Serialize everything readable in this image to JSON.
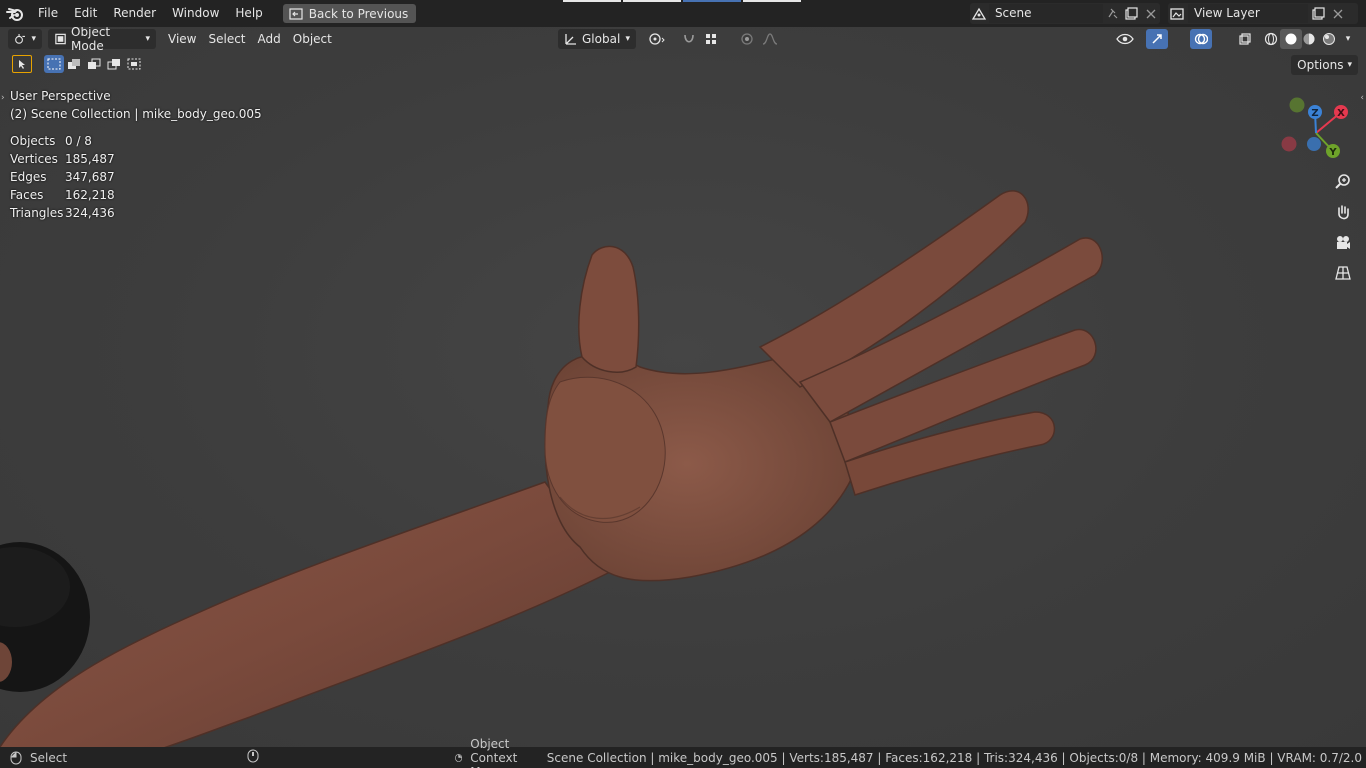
{
  "menu": {
    "items": [
      "File",
      "Edit",
      "Render",
      "Window",
      "Help"
    ],
    "back_label": "Back to Previous"
  },
  "scene": {
    "label": "Scene",
    "view_layer": "View Layer"
  },
  "header": {
    "mode_label": "Object Mode",
    "view": "View",
    "select": "Select",
    "add": "Add",
    "object": "Object",
    "transform_orientation": "Global",
    "options_label": "Options"
  },
  "overlay": {
    "perspective": "User Perspective",
    "collection": "(2) Scene Collection | mike_body_geo.005"
  },
  "stats": {
    "objects_label": "Objects",
    "objects_value": "0 / 8",
    "vertices_label": "Vertices",
    "vertices_value": "185,487",
    "edges_label": "Edges",
    "edges_value": "347,687",
    "faces_label": "Faces",
    "faces_value": "162,218",
    "triangles_label": "Triangles",
    "triangles_value": "324,436"
  },
  "gizmo": {
    "x": "X",
    "y": "Y",
    "z": "Z"
  },
  "status": {
    "select": "Select",
    "context_menu": "Object Context Menu",
    "info": "Scene Collection | mike_body_geo.005 | Verts:185,487 | Faces:162,218 | Tris:324,436 | Objects:0/8 | Memory: 409.9 MiB | VRAM: 0.7/2.0"
  },
  "colors": {
    "accent": "#4772b3",
    "skin": "#7a4a3c",
    "axis_x": "#e5394f",
    "axis_y": "#6ea32a",
    "axis_z": "#3b82d6"
  }
}
